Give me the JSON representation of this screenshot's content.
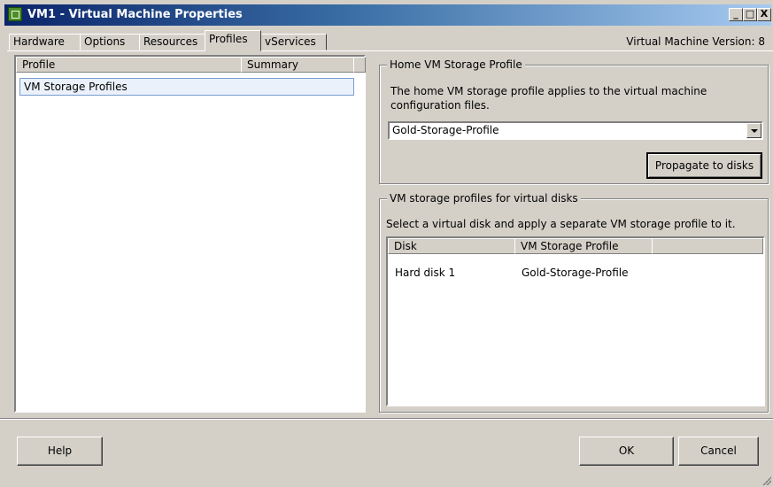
{
  "window": {
    "title": "VM1 - Virtual Machine Properties",
    "version": "Virtual Machine Version: 8"
  },
  "tabs": [
    {
      "label": "Hardware"
    },
    {
      "label": "Options"
    },
    {
      "label": "Resources"
    },
    {
      "label": "Profiles",
      "active": true
    },
    {
      "label": "vServices"
    }
  ],
  "left_list": {
    "columns": [
      "Profile",
      "Summary"
    ],
    "rows": [
      {
        "profile": "VM Storage Profiles",
        "summary": ""
      }
    ]
  },
  "home_profile": {
    "title": "Home VM Storage Profile",
    "description": "The home VM storage profile applies to the virtual machine configuration files.",
    "selected": "Gold-Storage-Profile",
    "propagate_label": "Propagate to disks"
  },
  "disk_profiles": {
    "title": "VM storage profiles for virtual disks",
    "description": "Select a virtual disk and apply a separate VM storage profile to it.",
    "columns": [
      "Disk",
      "VM Storage Profile"
    ],
    "rows": [
      {
        "disk": "Hard disk 1",
        "profile": "Gold-Storage-Profile"
      }
    ]
  },
  "footer": {
    "help": "Help",
    "ok": "OK",
    "cancel": "Cancel"
  },
  "window_controls": {
    "minimize": "_",
    "maximize": "□",
    "close": "X"
  }
}
